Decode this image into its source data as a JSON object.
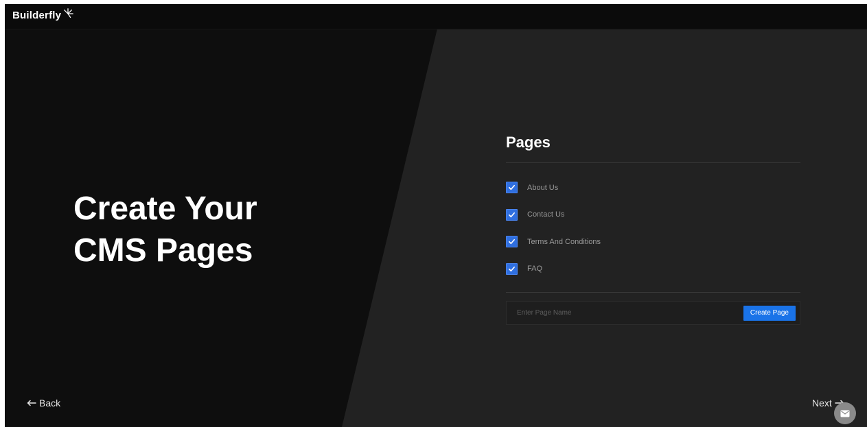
{
  "app": {
    "brand": "Builderfly",
    "logo_icon": "spark-star-icon"
  },
  "hero": {
    "line1": "Create Your",
    "line2": "CMS Pages"
  },
  "pages_panel": {
    "title": "Pages",
    "items": [
      {
        "label": "About Us",
        "checked": true
      },
      {
        "label": "Contact Us",
        "checked": true
      },
      {
        "label": "Terms And Conditions",
        "checked": true
      },
      {
        "label": "FAQ",
        "checked": true
      }
    ],
    "input": {
      "placeholder": "Enter Page Name",
      "value": ""
    },
    "create_button": "Create Page"
  },
  "nav": {
    "back_label": "Back",
    "next_label": "Next"
  },
  "fab": {
    "icon": "mail-icon"
  },
  "colors": {
    "accent": "#1a73e8",
    "checkbox": "#2f6fe0",
    "background_dark": "#0e0e0e",
    "background_panel": "#222222"
  }
}
